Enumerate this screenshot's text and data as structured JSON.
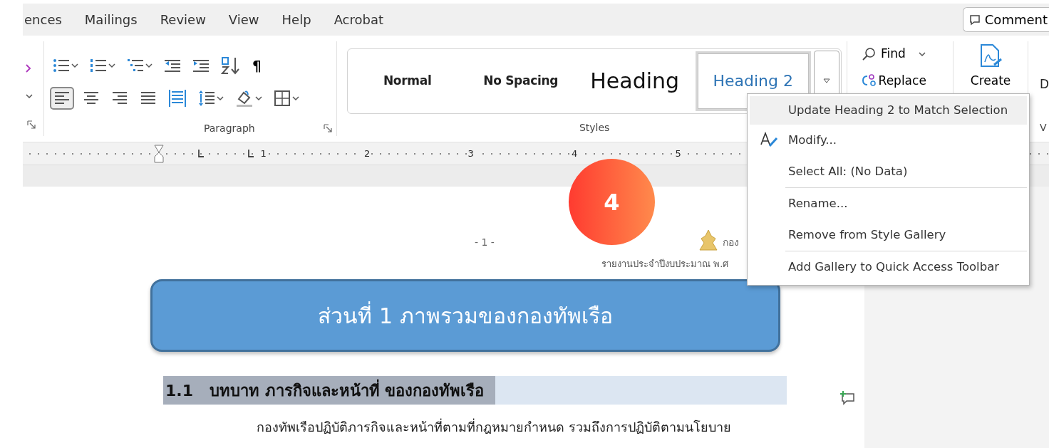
{
  "ribbon_tabs": [
    {
      "label": "ences"
    },
    {
      "label": "Mailings"
    },
    {
      "label": "Review"
    },
    {
      "label": "View"
    },
    {
      "label": "Help"
    },
    {
      "label": "Acrobat"
    }
  ],
  "comments_button": {
    "label": "Comment"
  },
  "paragraph_group": {
    "label": "Paragraph",
    "row1": [
      {
        "kind": "bullets",
        "dropdown": true
      },
      {
        "kind": "numbering",
        "dropdown": true
      },
      {
        "kind": "multilevel",
        "dropdown": true
      },
      {
        "kind": "outdent",
        "dropdown": false
      },
      {
        "kind": "indent",
        "dropdown": false
      },
      {
        "kind": "sort",
        "dropdown": false
      }
    ],
    "show_marks": "¶",
    "row2": [
      {
        "kind": "align-left",
        "dropdown": false,
        "selected": true
      },
      {
        "kind": "align-center",
        "dropdown": false,
        "selected": false
      },
      {
        "kind": "align-right",
        "dropdown": false,
        "selected": false
      },
      {
        "kind": "justify",
        "dropdown": false,
        "selected": false
      },
      {
        "kind": "distributed",
        "dropdown": false,
        "selected": false
      },
      {
        "kind": "line-spacing",
        "dropdown": true,
        "selected": false
      },
      {
        "kind": "shading",
        "dropdown": true,
        "selected": false
      },
      {
        "kind": "borders",
        "dropdown": true,
        "selected": false
      }
    ]
  },
  "styles_group": {
    "label": "Styles",
    "styles": [
      {
        "label": "Normal",
        "kind": "body",
        "selected": false
      },
      {
        "label": "No Spacing",
        "kind": "body",
        "selected": false
      },
      {
        "label": "Heading",
        "kind": "heading1",
        "selected": false
      },
      {
        "label": "Heading 2",
        "kind": "heading2",
        "selected": true
      }
    ]
  },
  "editing": {
    "find": "Find",
    "replace": "Replace"
  },
  "create": {
    "label": "Create"
  },
  "right_cut": {
    "button": "D",
    "group": "V"
  },
  "ruler": {
    "numbers": [
      "1",
      "2",
      "3",
      "4",
      "5"
    ]
  },
  "step_badge": "4",
  "document": {
    "page_number": "- 1 -",
    "header_org": "กอง",
    "header_subtitle": "รายงานประจำปีงบประมาณ พ.ศ",
    "banner_title": "ส่วนที่ 1 ภาพรวมของกองทัพเรือ",
    "heading": "1.1   บทบาท ภารกิจและหน้าที่ ของกองทัพเรือ",
    "body_line": "กองทัพเรือปฏิบัติภารกิจและหน้าที่ตามที่กฎหมายกำหนด รวมถึงการปฏิบัติตามนโยบาย"
  },
  "context_menu": {
    "items": [
      {
        "label": "Update Heading 2 to Match Selection",
        "highlighted": true,
        "separator_before": false,
        "icon": false
      },
      {
        "label": "Modify...",
        "highlighted": false,
        "separator_before": false,
        "icon": true
      },
      {
        "label": "Select All: (No Data)",
        "highlighted": false,
        "separator_before": false,
        "icon": false
      },
      {
        "label": "Rename...",
        "highlighted": false,
        "separator_before": true,
        "icon": false
      },
      {
        "label": "Remove from Style Gallery",
        "highlighted": false,
        "separator_before": false,
        "icon": false
      },
      {
        "label": "Add Gallery to Quick Access Toolbar",
        "highlighted": false,
        "separator_before": true,
        "icon": false
      }
    ]
  }
}
